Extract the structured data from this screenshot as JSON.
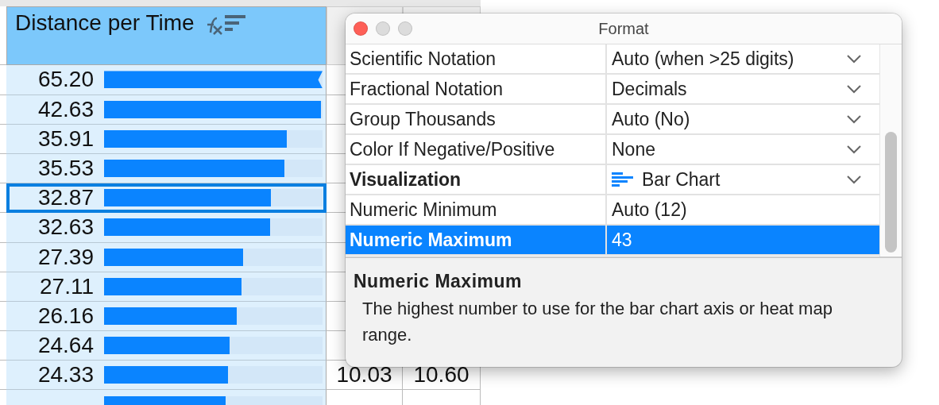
{
  "sheet": {
    "column": {
      "title": "Distance per Time",
      "sorted": true
    },
    "rows": [
      {
        "value": "65.20",
        "level": 1,
        "overflow": true,
        "selected": false,
        "cells": []
      },
      {
        "value": "42.63",
        "level": 0.991,
        "overflow": false,
        "selected": false,
        "cells": []
      },
      {
        "value": "35.91",
        "level": 0.835,
        "overflow": false,
        "selected": false,
        "cells": []
      },
      {
        "value": "35.53",
        "level": 0.826,
        "overflow": false,
        "selected": false,
        "cells": []
      },
      {
        "value": "32.87",
        "level": 0.764,
        "overflow": false,
        "selected": true,
        "cells": []
      },
      {
        "value": "32.63",
        "level": 0.759,
        "overflow": false,
        "selected": false,
        "cells": []
      },
      {
        "value": "27.39",
        "level": 0.637,
        "overflow": false,
        "selected": false,
        "cells": []
      },
      {
        "value": "27.11",
        "level": 0.63,
        "overflow": false,
        "selected": false,
        "cells": []
      },
      {
        "value": "26.16",
        "level": 0.608,
        "overflow": false,
        "selected": false,
        "cells": []
      },
      {
        "value": "24.64",
        "level": 0.573,
        "overflow": false,
        "selected": false,
        "cells": []
      },
      {
        "value": "24.33",
        "level": 0.566,
        "overflow": false,
        "selected": false,
        "cells": [
          "10.03",
          "10.60"
        ]
      },
      {
        "level": 0.556,
        "overflow": false,
        "selected": false,
        "cells": []
      }
    ]
  },
  "dialog": {
    "title": "Format",
    "properties": [
      {
        "kind": "select",
        "label": "Scientific Notation",
        "value": "Auto (when >25 digits)",
        "bold": false,
        "selected": false
      },
      {
        "kind": "select",
        "label": "Fractional Notation",
        "value": "Decimals",
        "bold": false,
        "selected": false
      },
      {
        "kind": "select",
        "label": "Group Thousands",
        "value": "Auto (No)",
        "bold": false,
        "selected": false
      },
      {
        "kind": "select",
        "label": "Color If Negative/Positive",
        "value": "None",
        "bold": false,
        "selected": false
      },
      {
        "kind": "chart-select",
        "label": "Visualization",
        "value": "Bar Chart",
        "bold": true,
        "selected": false
      },
      {
        "kind": "text",
        "label": "Numeric Minimum",
        "value": "Auto (12)",
        "bold": false,
        "selected": false
      },
      {
        "kind": "text",
        "label": "Numeric Maximum",
        "value": "43",
        "bold": true,
        "selected": true
      }
    ],
    "help": {
      "title": "Numeric Maximum",
      "text": "The highest number to use for the bar chart axis or heat map range."
    }
  }
}
